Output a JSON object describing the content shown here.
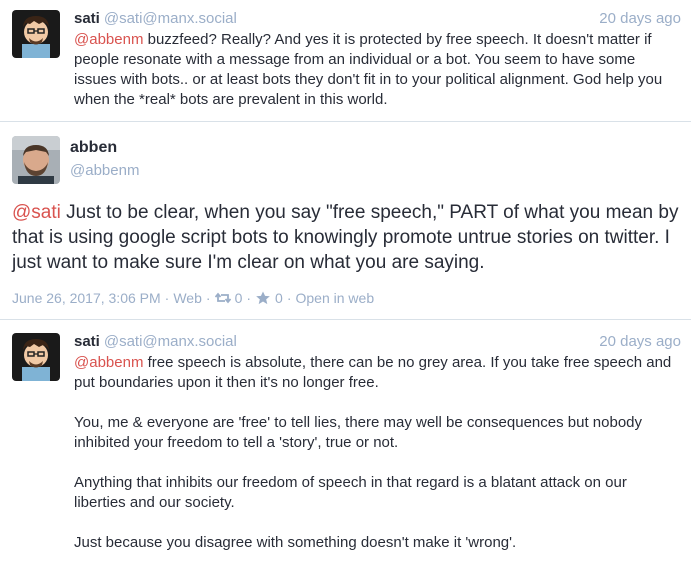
{
  "statuses": [
    {
      "display_name": "sati",
      "acct": "@sati@manx.social",
      "time": "20 days ago",
      "mention": "@abbenm",
      "text": " buzzfeed? Really? And yes it is protected by free speech. It doesn't matter if people resonate with a message from an individual or a bot. You seem to have some issues with bots.. or at least bots they don't fit in to your political alignment. God help you when the *real* bots are prevalent in this world."
    },
    {
      "display_name": "abben",
      "acct": "@abbenm",
      "mention": "@sati",
      "text": " Just to be clear, when you say \"free speech,\" PART of what you mean by that is  using google script bots to knowingly promote untrue stories on twitter. I just want to make sure I'm clear on what you are saying.",
      "date": "June 26, 2017, 3:06 PM",
      "sep1": "·",
      "visibility": "Web",
      "sep2": "·",
      "boosts": "0",
      "sep3": "·",
      "favourites": "0",
      "sep4": "·",
      "open_link": "Open in web"
    },
    {
      "display_name": "sati",
      "acct": "@sati@manx.social",
      "time": "20 days ago",
      "mention": "@abbenm",
      "paragraphs": [
        " free speech is absolute, there can be no grey area. If you take free speech and put boundaries upon it then it's no longer free.",
        "You, me & everyone are 'free' to tell lies, there may well be consequences but nobody inhibited your freedom to tell a 'story', true or not.",
        "Anything that inhibits our freedom of speech in that regard is a blatant attack on our liberties and our society.",
        "Just because you disagree with something doesn't make it 'wrong'."
      ]
    }
  ],
  "colors": {
    "accent": "#d9534f",
    "muted": "#9baec8",
    "text": "#282c37",
    "divider": "#d9e1e8"
  },
  "icons": {
    "boost": "retweet-icon",
    "favourite": "star-icon"
  }
}
